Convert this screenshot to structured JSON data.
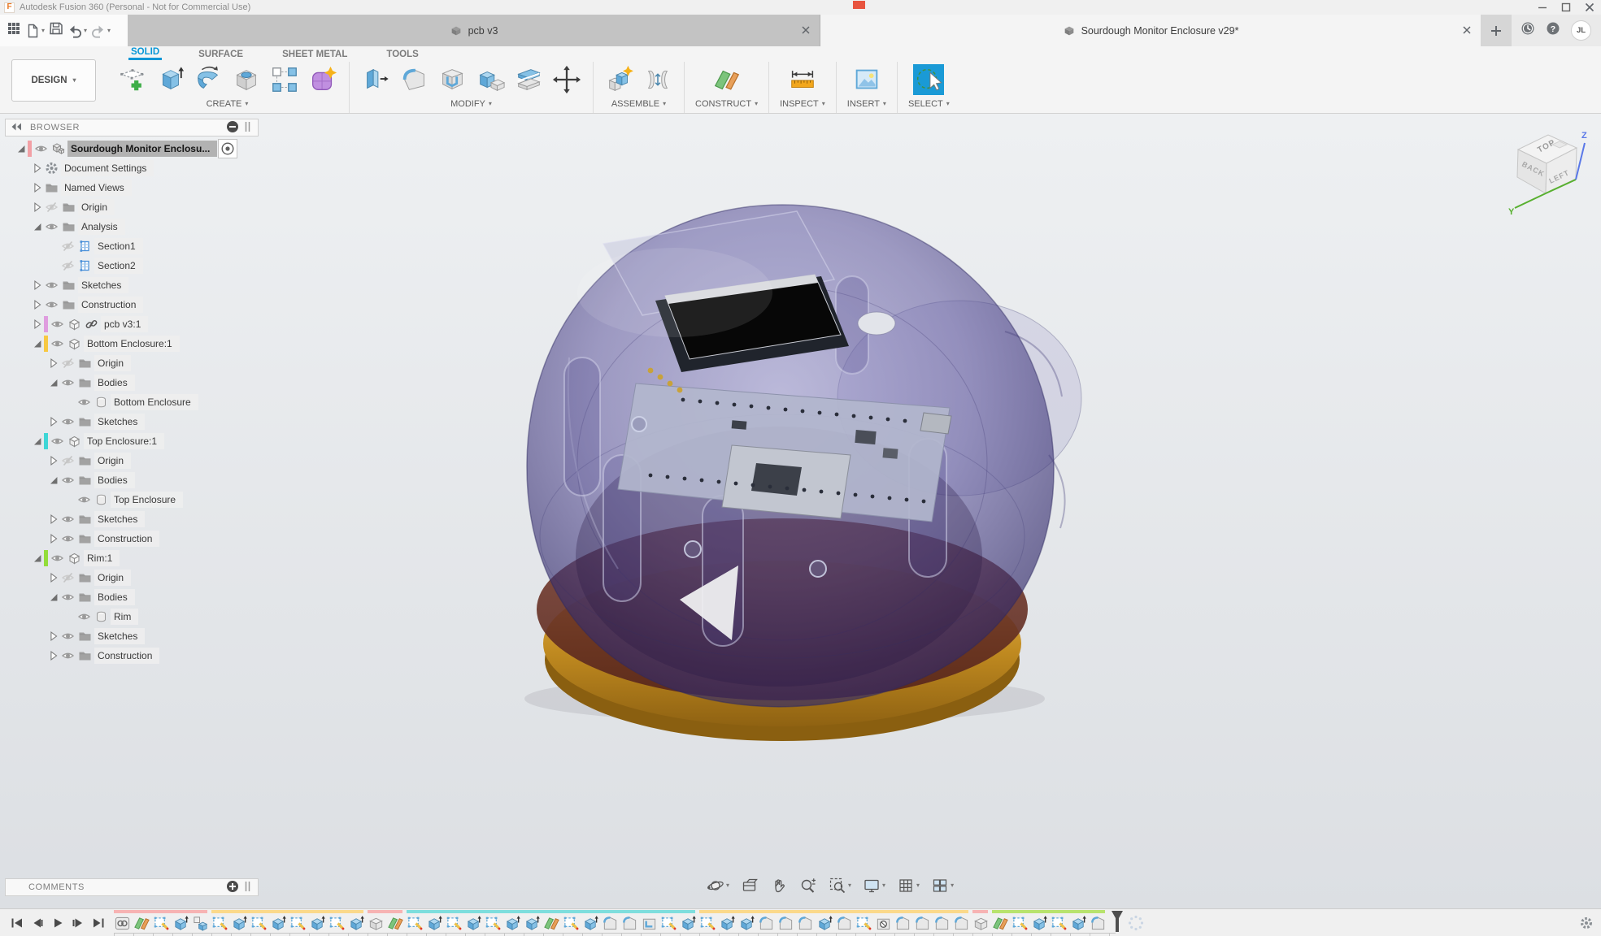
{
  "window": {
    "title": "Autodesk Fusion 360 (Personal - Not for Commercial Use)"
  },
  "app_bar": {
    "tabs": [
      {
        "label": "pcb v3",
        "active": false
      },
      {
        "label": "Sourdough Monitor Enclosure v29*",
        "active": true
      }
    ],
    "user_avatar": "JL"
  },
  "ribbon": {
    "workspace_label": "DESIGN",
    "tabs": [
      {
        "label": "SOLID",
        "active": true
      },
      {
        "label": "SURFACE",
        "active": false
      },
      {
        "label": "SHEET METAL",
        "active": false
      },
      {
        "label": "TOOLS",
        "active": false
      }
    ],
    "groups": [
      {
        "label": "CREATE",
        "icons": [
          "create-sketch",
          "extrude",
          "revolve",
          "hole",
          "pattern",
          "form"
        ]
      },
      {
        "label": "MODIFY",
        "icons": [
          "press-pull",
          "fillet",
          "shell",
          "combine",
          "split",
          "move"
        ]
      },
      {
        "label": "ASSEMBLE",
        "icons": [
          "new-component",
          "joint"
        ]
      },
      {
        "label": "CONSTRUCT",
        "icons": [
          "plane"
        ]
      },
      {
        "label": "INSPECT",
        "icons": [
          "measure"
        ]
      },
      {
        "label": "INSERT",
        "icons": [
          "insert-image"
        ]
      },
      {
        "label": "SELECT",
        "icons": [
          "select"
        ]
      }
    ]
  },
  "browser": {
    "title": "BROWSER",
    "rows": [
      {
        "l": 0,
        "e": "open",
        "bar": "#f2a0a5",
        "eye": "on",
        "ic": "doc",
        "t": "Sourdough Monitor Enclosu...",
        "sel": true,
        "radio": true
      },
      {
        "l": 1,
        "e": "closed",
        "ic": "gear",
        "t": "Document Settings"
      },
      {
        "l": 1,
        "e": "closed",
        "ic": "folder",
        "t": "Named Views"
      },
      {
        "l": 1,
        "e": "closed",
        "eye": "off",
        "ic": "folder",
        "t": "Origin"
      },
      {
        "l": 1,
        "e": "open",
        "eye": "on",
        "ic": "folder",
        "t": "Analysis"
      },
      {
        "l": 2,
        "eye": "off",
        "ic": "section",
        "t": "Section1"
      },
      {
        "l": 2,
        "eye": "off",
        "ic": "section",
        "t": "Section2"
      },
      {
        "l": 1,
        "e": "closed",
        "eye": "on",
        "ic": "folder",
        "t": "Sketches"
      },
      {
        "l": 1,
        "e": "closed",
        "eye": "on",
        "ic": "folder",
        "t": "Construction"
      },
      {
        "l": 1,
        "e": "closed",
        "bar": "#df9ddf",
        "eye": "on",
        "ic": "comp",
        "t": "pcb v3:1",
        "link": true
      },
      {
        "l": 1,
        "e": "open",
        "bar": "#f7c843",
        "eye": "on",
        "ic": "comp",
        "t": "Bottom Enclosure:1"
      },
      {
        "l": 2,
        "e": "closed",
        "eye": "off",
        "ic": "folder",
        "t": "Origin"
      },
      {
        "l": 2,
        "e": "open",
        "eye": "on",
        "ic": "folder",
        "t": "Bodies"
      },
      {
        "l": 3,
        "eye": "on",
        "ic": "body",
        "t": "Bottom Enclosure"
      },
      {
        "l": 2,
        "e": "closed",
        "eye": "on",
        "ic": "folder",
        "t": "Sketches"
      },
      {
        "l": 1,
        "e": "open",
        "bar": "#3fd6d6",
        "eye": "on",
        "ic": "comp",
        "t": "Top Enclosure:1"
      },
      {
        "l": 2,
        "e": "closed",
        "eye": "off",
        "ic": "folder",
        "t": "Origin"
      },
      {
        "l": 2,
        "e": "open",
        "eye": "on",
        "ic": "folder",
        "t": "Bodies"
      },
      {
        "l": 3,
        "eye": "on",
        "ic": "body",
        "t": "Top Enclosure"
      },
      {
        "l": 2,
        "e": "closed",
        "eye": "on",
        "ic": "folder",
        "t": "Sketches"
      },
      {
        "l": 2,
        "e": "closed",
        "eye": "on",
        "ic": "folder",
        "t": "Construction"
      },
      {
        "l": 1,
        "e": "open",
        "bar": "#93dd3a",
        "eye": "on",
        "ic": "comp",
        "t": "Rim:1"
      },
      {
        "l": 2,
        "e": "closed",
        "eye": "off",
        "ic": "folder",
        "t": "Origin"
      },
      {
        "l": 2,
        "e": "open",
        "eye": "on",
        "ic": "folder",
        "t": "Bodies"
      },
      {
        "l": 3,
        "eye": "on",
        "ic": "body",
        "t": "Rim"
      },
      {
        "l": 2,
        "e": "closed",
        "eye": "on",
        "ic": "folder",
        "t": "Sketches"
      },
      {
        "l": 2,
        "e": "closed",
        "eye": "on",
        "ic": "folder",
        "t": "Construction"
      }
    ]
  },
  "comments": {
    "title": "COMMENTS"
  },
  "viewcube": {
    "top": "TOP",
    "back": "BACK",
    "left": "LEFT",
    "axis_y": "Y",
    "axis_z": "Z"
  },
  "navbar": {
    "buttons": [
      {
        "icon": "orbit",
        "caret": true
      },
      {
        "icon": "look-at"
      },
      {
        "icon": "pan"
      },
      {
        "icon": "zoom"
      },
      {
        "icon": "fit",
        "caret": true
      },
      {
        "icon": "display-settings",
        "caret": true
      },
      {
        "icon": "grid-snaps",
        "caret": true
      },
      {
        "icon": "viewports",
        "caret": true
      }
    ]
  },
  "timeline": {
    "items": [
      "link",
      "plane",
      "sketch",
      "extrude",
      "component",
      "sketch",
      "extrude",
      "sketch",
      "extrude",
      "sketch",
      "extrude",
      "sketch",
      "extrude",
      "box",
      "plane",
      "sketch",
      "extrude",
      "sketch",
      "extrude",
      "sketch",
      "extrude",
      "extrude",
      "plane",
      "sketch",
      "extrude",
      "fillet",
      "fillet",
      "shell",
      "sketch",
      "extrude",
      "sketch",
      "extrude",
      "extrude",
      "fillet",
      "fillet",
      "fillet",
      "extrude",
      "fillet",
      "sketch",
      "hole",
      "fillet",
      "fillet",
      "fillet",
      "fillet",
      "box",
      "plane",
      "sketch",
      "extrude",
      "sketch",
      "extrude",
      "fillet"
    ],
    "groups": [
      {
        "color": "#f7b3b3",
        "count": 5
      },
      {
        "color": "#fbd98b",
        "count": 8
      },
      {
        "color": "#f7b3b3",
        "count": 2
      },
      {
        "color": "#7ededd",
        "count": 15
      },
      {
        "color": "#fbd98b",
        "count": 14
      },
      {
        "color": "#f7b3b3",
        "count": 1
      },
      {
        "color": "#b8e36d",
        "count": 6
      }
    ]
  },
  "colors": {
    "accent_blue": "#0696d7",
    "select_active": "#1a9ad6",
    "dome_purple": "#5a5280",
    "rim_gold": "#cf9a2e",
    "rim_maroon": "#6e3226"
  }
}
